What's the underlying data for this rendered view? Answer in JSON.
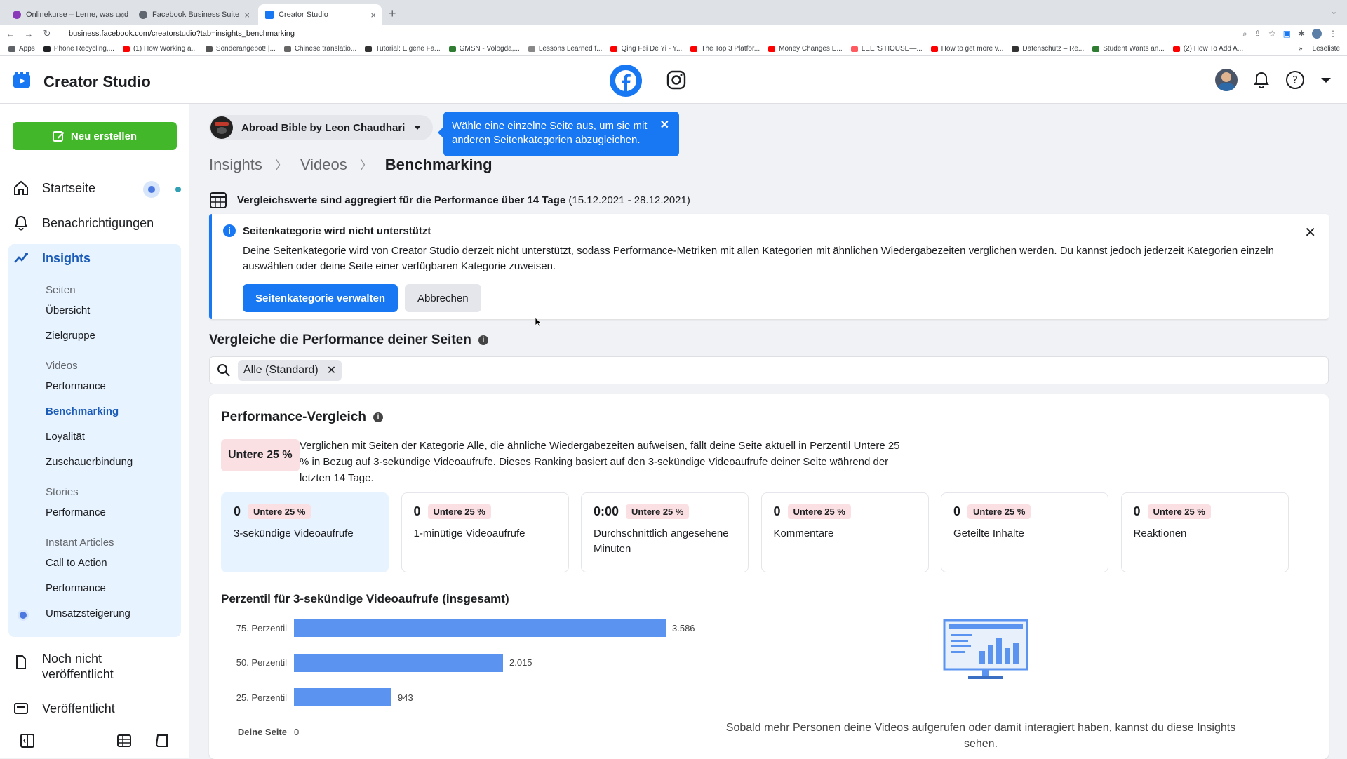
{
  "browser": {
    "tabs": [
      {
        "title": "Onlinekurse – Lerne, was und w",
        "color": "#8a3ab9"
      },
      {
        "title": "Facebook Business Suite",
        "color": "#606770"
      },
      {
        "title": "Creator Studio",
        "color": "#1877f2"
      }
    ],
    "new_tab": "+",
    "url": "business.facebook.com/creatorstudio?tab=insights_benchmarking",
    "bookmarks": [
      {
        "label": "Apps",
        "color": "#5f6368"
      },
      {
        "label": "Phone Recycling,...",
        "color": "#202124"
      },
      {
        "label": "(1) How Working a...",
        "color": "#ff0000"
      },
      {
        "label": "Sonderangebot! |...",
        "color": "#555"
      },
      {
        "label": "Chinese translatio...",
        "color": "#666"
      },
      {
        "label": "Tutorial: Eigene Fa...",
        "color": "#333"
      },
      {
        "label": "GMSN - Vologda,...",
        "color": "#2e7d32"
      },
      {
        "label": "Lessons Learned f...",
        "color": "#888"
      },
      {
        "label": "Qing Fei De Yi - Y...",
        "color": "#ff0000"
      },
      {
        "label": "The Top 3 Platfor...",
        "color": "#ff0000"
      },
      {
        "label": "Money Changes E...",
        "color": "#ff0000"
      },
      {
        "label": "LEE 'S HOUSE—...",
        "color": "#ff5a5f"
      },
      {
        "label": "How to get more v...",
        "color": "#ff0000"
      },
      {
        "label": "Datenschutz – Re...",
        "color": "#333"
      },
      {
        "label": "Student Wants an...",
        "color": "#2e7d32"
      },
      {
        "label": "(2) How To Add A...",
        "color": "#ff0000"
      }
    ],
    "bookmarks_more": "»",
    "reading_list": "Leseliste"
  },
  "app": {
    "title": "Creator Studio"
  },
  "sidebar": {
    "new_button": "Neu erstellen",
    "home": "Startseite",
    "notifications": "Benachrichtigungen",
    "insights": "Insights",
    "sections": [
      {
        "heading": "Seiten",
        "items": [
          "Übersicht",
          "Zielgruppe"
        ]
      },
      {
        "heading": "Videos",
        "items": [
          "Performance",
          "Benchmarking",
          "Loyalität",
          "Zuschauerbindung"
        ]
      },
      {
        "heading": "Stories",
        "items": [
          "Performance"
        ]
      },
      {
        "heading": "Instant Articles",
        "items": [
          "Call to Action",
          "Performance",
          "Umsatzsteigerung"
        ]
      }
    ],
    "unpublished": "Noch nicht veröffentlicht",
    "published": "Veröffentlicht"
  },
  "page_selector": {
    "name": "Abroad Bible by Leon Chaudhari"
  },
  "tooltip": {
    "text": "Wähle eine einzelne Seite aus, um sie mit anderen Seitenkategorien abzugleichen."
  },
  "breadcrumb": [
    "Insights",
    "Videos",
    "Benchmarking"
  ],
  "aggregation": {
    "text": "Vergleichswerte sind aggregiert für die Performance über 14 Tage",
    "range": "(15.12.2021 - 28.12.2021)"
  },
  "notice": {
    "title": "Seitenkategorie wird nicht unterstützt",
    "body": "Deine Seitenkategorie wird von Creator Studio derzeit nicht unterstützt, sodass Performance-Metriken mit allen Kategorien mit ähnlichen Wiedergabezeiten verglichen werden. Du kannst jedoch jederzeit Kategorien einzeln auswählen oder deine Seite einer verfügbaren Kategorie zuweisen.",
    "primary_button": "Seitenkategorie verwalten",
    "secondary_button": "Abbrechen"
  },
  "compare": {
    "title": "Vergleiche die Performance deiner Seiten",
    "chip": "Alle (Standard)"
  },
  "performance": {
    "title": "Performance-Vergleich",
    "rank_badge": "Untere 25 %",
    "rank_text": "Verglichen mit Seiten der Kategorie Alle, die ähnliche Wiedergabezeiten aufweisen, fällt deine Seite aktuell in Perzentil Untere 25 % in Bezug auf 3-sekündige Videoaufrufe. Dieses Ranking basiert auf den 3-sekündige Videoaufrufe deiner Seite während der letzten 14 Tage.",
    "metrics": [
      {
        "value": "0",
        "badge": "Untere 25 %",
        "label": "3-sekündige Videoaufrufe"
      },
      {
        "value": "0",
        "badge": "Untere 25 %",
        "label": "1-minütige Videoaufrufe"
      },
      {
        "value": "0:00",
        "badge": "Untere 25 %",
        "label": "Durchschnittlich angesehene Minuten"
      },
      {
        "value": "0",
        "badge": "Untere 25 %",
        "label": "Kommentare"
      },
      {
        "value": "0",
        "badge": "Untere 25 %",
        "label": "Geteilte Inhalte"
      },
      {
        "value": "0",
        "badge": "Untere 25 %",
        "label": "Reaktionen"
      }
    ]
  },
  "percentile": {
    "title": "Perzentil für 3-sekündige Videoaufrufe (insgesamt)",
    "rows": [
      {
        "label": "75. Perzentil",
        "value": 3586,
        "display": "3.586"
      },
      {
        "label": "50. Perzentil",
        "value": 2015,
        "display": "2.015"
      },
      {
        "label": "25. Perzentil",
        "value": 943,
        "display": "943"
      },
      {
        "label": "Deine Seite",
        "value": 0,
        "display": "0"
      }
    ],
    "empty_text": "Sobald mehr Personen deine Videos aufgerufen oder damit interagiert haben, kannst du diese Insights sehen."
  }
}
